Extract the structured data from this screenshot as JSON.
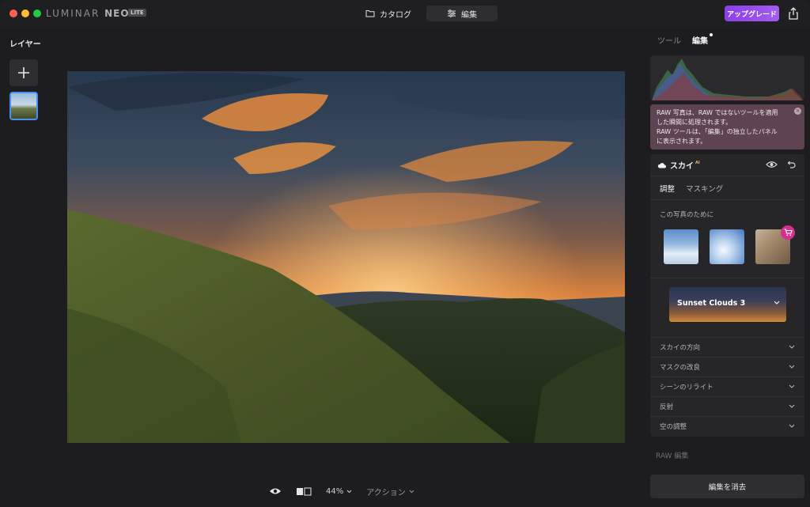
{
  "app": {
    "brand_main": "LUMINAR",
    "brand_neo": "NEO",
    "lite_badge": "LITE"
  },
  "titlebar": {
    "tabs": [
      {
        "label": "カタログ",
        "icon": "folder-icon"
      },
      {
        "label": "編集",
        "icon": "sliders-icon",
        "active": true
      }
    ],
    "upgrade_label": "アップグレード",
    "share_icon": "share-icon"
  },
  "layers": {
    "title": "レイヤー",
    "add_icon": "plus-icon"
  },
  "bottombar": {
    "zoom": "44%",
    "actions_label": "アクション"
  },
  "right_panel": {
    "tabs": [
      "ツール",
      "編集"
    ],
    "active_tab": "編集",
    "notice": {
      "line1": "RAW 写真は、RAW ではないツールを適用",
      "line2": "した瞬間に処理されます。",
      "line3": "RAW ツールは、「編集」の独立したパネル",
      "line4": "に表示されます。"
    },
    "sky": {
      "title": "スカイ",
      "ai_badge": "AI",
      "sub_tabs": [
        "調整",
        "マスキング"
      ],
      "active_sub_tab": "調整",
      "for_photo_label": "この写真のために",
      "selected_sky": "Sunset Clouds 3",
      "sections": [
        "スカイの方向",
        "マスクの改良",
        "シーンのリライト",
        "反射",
        "空の調整"
      ]
    },
    "raw_edit_label": "RAW 編集",
    "clear_edit_label": "編集を消去"
  },
  "colors": {
    "accent_purple": "#9a4cf0",
    "notice_bg": "#5e4452",
    "cart_pink": "#d4318f",
    "selected_blue": "#4a8ff0"
  }
}
